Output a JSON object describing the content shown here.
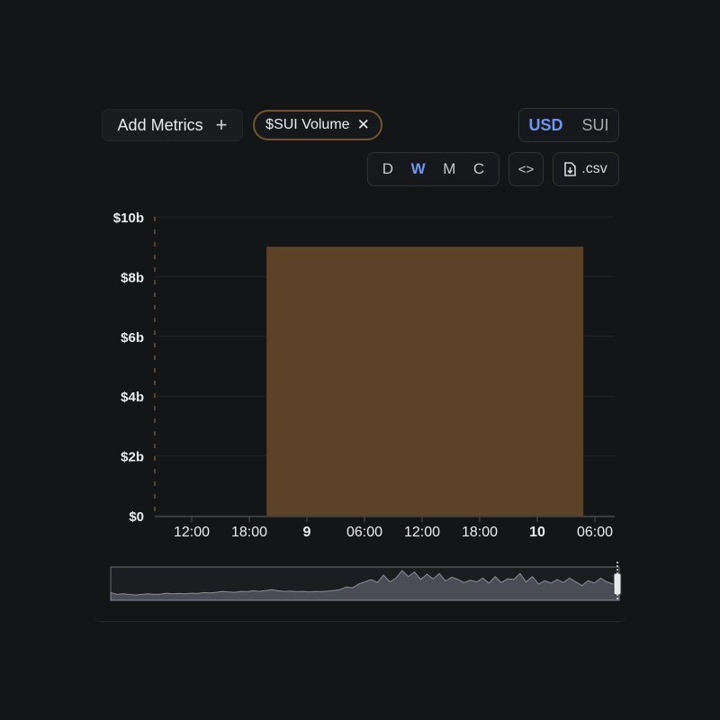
{
  "toolbar": {
    "add_metrics_label": "Add Metrics",
    "add_icon": "plus-icon",
    "metric_chip_label": "$SUI Volume",
    "remove_icon": "close-icon",
    "currency": {
      "options": [
        "USD",
        "SUI"
      ],
      "selected": "USD"
    },
    "period": {
      "options": [
        "D",
        "W",
        "M",
        "C"
      ],
      "selected": "W"
    },
    "embed_icon": "code-icon",
    "csv_label": ".csv",
    "csv_icon": "file-download-icon"
  },
  "colors": {
    "background": "#141517",
    "bar": "#5c4327",
    "accent": "#6f95f0",
    "chip_border": "#6f5530",
    "navigator_fill": "#4a4d56"
  },
  "chart_data": {
    "type": "bar",
    "title": "",
    "xlabel": "",
    "ylabel": "",
    "ylim": [
      0,
      10
    ],
    "y_unit": "b",
    "y_ticks": [
      "$0",
      "$2b",
      "$4b",
      "$6b",
      "$8b",
      "$10b"
    ],
    "x_ticks": [
      {
        "label": "12:00",
        "bold": false
      },
      {
        "label": "18:00",
        "bold": false
      },
      {
        "label": "9",
        "bold": true
      },
      {
        "label": "06:00",
        "bold": false
      },
      {
        "label": "12:00",
        "bold": false
      },
      {
        "label": "18:00",
        "bold": false
      },
      {
        "label": "10",
        "bold": true
      },
      {
        "label": "06:00",
        "bold": false
      }
    ],
    "series": [
      {
        "values": [
          {
            "start_tick": 1.3,
            "end_tick": 6.8,
            "value": 9.0
          }
        ]
      }
    ],
    "grid": true,
    "navigator": {
      "values": [
        0.26,
        0.2,
        0.22,
        0.2,
        0.18,
        0.2,
        0.22,
        0.2,
        0.21,
        0.24,
        0.22,
        0.23,
        0.22,
        0.24,
        0.23,
        0.26,
        0.25,
        0.27,
        0.3,
        0.28,
        0.27,
        0.3,
        0.29,
        0.32,
        0.3,
        0.33,
        0.36,
        0.32,
        0.3,
        0.31,
        0.29,
        0.3,
        0.28,
        0.3,
        0.29,
        0.31,
        0.33,
        0.36,
        0.45,
        0.42,
        0.55,
        0.62,
        0.7,
        0.6,
        0.85,
        0.62,
        0.75,
        1.0,
        0.8,
        0.95,
        0.7,
        0.88,
        0.72,
        0.9,
        0.65,
        0.78,
        0.7,
        0.6,
        0.68,
        0.62,
        0.75,
        0.58,
        0.8,
        0.6,
        0.72,
        0.7,
        0.9,
        0.62,
        0.8,
        0.55,
        0.66,
        0.58,
        0.7,
        0.6,
        0.75,
        0.62,
        0.5,
        0.66,
        0.58,
        0.75,
        0.62,
        0.55,
        0.6
      ]
    }
  }
}
